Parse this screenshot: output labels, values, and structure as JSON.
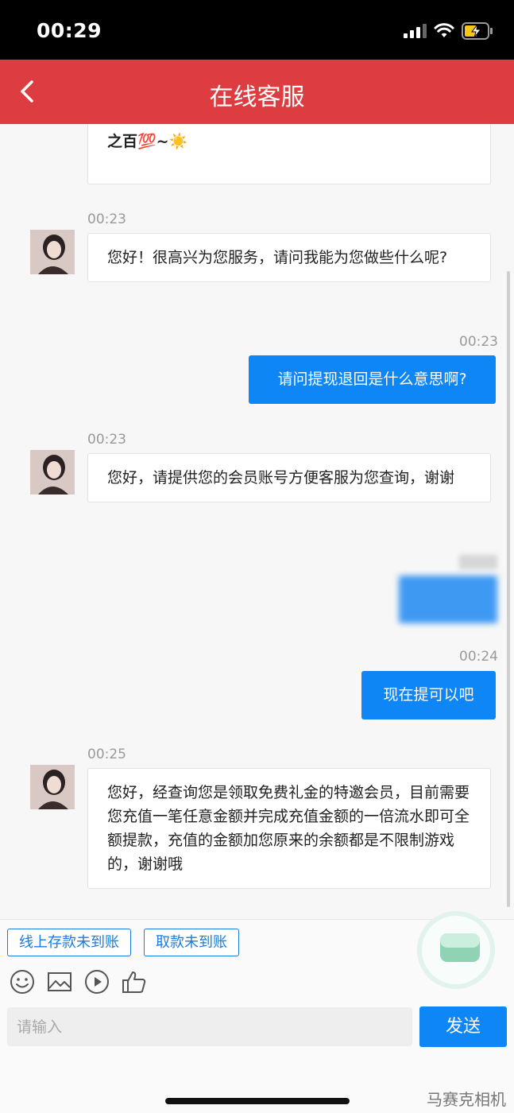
{
  "status_bar": {
    "time": "00:29"
  },
  "header": {
    "title": "在线客服"
  },
  "messages": [
    {
      "id": "m0",
      "from": "agent",
      "text": "之百💯~☀️"
    },
    {
      "id": "m1",
      "from": "agent",
      "time": "00:23",
      "text": "您好！很高兴为您服务，请问我能为您做些什么呢?"
    },
    {
      "id": "m2",
      "from": "user",
      "time": "00:23",
      "text": "请问提现退回是什么意思啊?"
    },
    {
      "id": "m3",
      "from": "agent",
      "time": "00:23",
      "text": "您好，请提供您的会员账号方便客服为您查询，谢谢"
    },
    {
      "id": "m4",
      "from": "user",
      "time": "00:23",
      "text": ""
    },
    {
      "id": "m5",
      "from": "user",
      "time": "00:24",
      "text": "现在提可以吧"
    },
    {
      "id": "m6",
      "from": "agent",
      "time": "00:25",
      "text": "您好，经查询您是领取免费礼金的特邀会员，目前需要您充值一笔任意金额并完成充值金额的一倍流水即可全额提款，充值的金额加您原来的余额都是不限制游戏的，谢谢哦"
    }
  ],
  "quick_replies": [
    "线上存款未到账",
    "取款未到账"
  ],
  "toolbar": [
    "emoji-icon",
    "image-icon",
    "video-icon",
    "like-icon"
  ],
  "composer": {
    "placeholder": "请输入",
    "send_label": "发送"
  },
  "watermark": "马赛克相机",
  "colors": {
    "header": "#dd3c40",
    "accent": "#0f86f5",
    "quick_reply": "#1a7be0"
  }
}
